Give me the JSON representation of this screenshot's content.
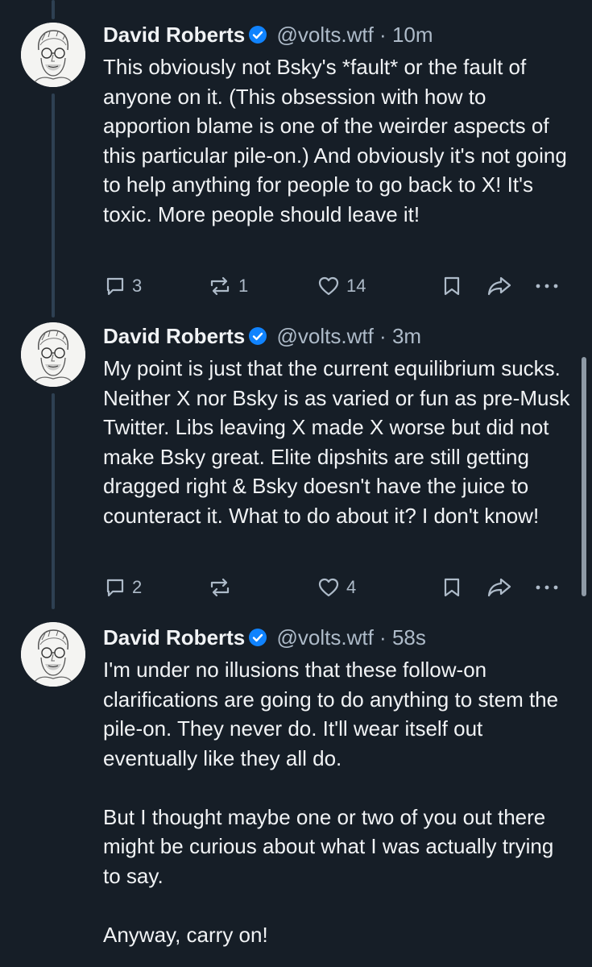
{
  "posts": [
    {
      "author_name": "David Roberts",
      "handle": "@volts.wtf",
      "separator": "·",
      "time": "10m",
      "text": "This obviously not Bsky's *fault* or the fault of anyone on it. (This obsession with how to apportion blame is one of the weirder aspects of this particular pile-on.) And obviously it's not going to help anything for people to go back to X! It's toxic. More people should leave it!",
      "replies": "3",
      "reposts": "1",
      "likes": "14"
    },
    {
      "author_name": "David Roberts",
      "handle": "@volts.wtf",
      "separator": "·",
      "time": "3m",
      "text": "My point is just that the current equilibrium sucks. Neither X nor Bsky is as varied or fun as pre-Musk Twitter. Libs leaving X made X worse but did not make Bsky great. Elite dipshits are still getting dragged right & Bsky doesn't have the juice to counteract it. What to do about it? I don't know!",
      "replies": "2",
      "reposts": "",
      "likes": "4"
    },
    {
      "author_name": "David Roberts",
      "handle": "@volts.wtf",
      "separator": "·",
      "time": "58s",
      "text": "I'm under no illusions that these follow-on clarifications are going to do anything to stem the pile-on. They never do. It'll wear itself out eventually like they all do.\n\nBut I thought maybe one or two of you out there might be curious about what I was actually trying to say.\n\nAnyway, carry on!"
    }
  ],
  "icons": {
    "reply": "reply-icon",
    "repost": "repost-icon",
    "like": "heart-icon",
    "bookmark": "bookmark-icon",
    "share": "share-icon",
    "more": "more-icon",
    "verified": "verified-badge-icon"
  },
  "colors": {
    "background": "#161e27",
    "text": "#f1f3f5",
    "muted": "#aebbc9",
    "verified": "#1083fe",
    "thread_line": "#2e4052"
  }
}
